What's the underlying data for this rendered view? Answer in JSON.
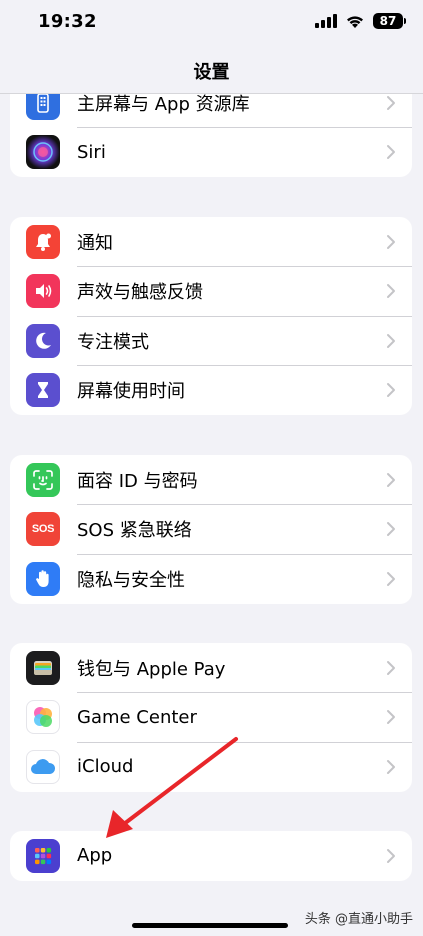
{
  "status": {
    "time": "19:32",
    "battery": "87"
  },
  "nav": {
    "title": "设置"
  },
  "groups": [
    {
      "items": [
        {
          "label": "主屏幕与 App 资源库",
          "icon": "home-screen-icon",
          "color": "#2f6fe0"
        },
        {
          "label": "Siri",
          "icon": "siri-icon",
          "color": "#1c1c2e"
        }
      ]
    },
    {
      "items": [
        {
          "label": "通知",
          "icon": "bell-icon",
          "color": "#f44336"
        },
        {
          "label": "声效与触感反馈",
          "icon": "speaker-icon",
          "color": "#f2355b"
        },
        {
          "label": "专注模式",
          "icon": "moon-icon",
          "color": "#5b4fcf"
        },
        {
          "label": "屏幕使用时间",
          "icon": "hourglass-icon",
          "color": "#5b4fcf"
        }
      ]
    },
    {
      "items": [
        {
          "label": "面容 ID 与密码",
          "icon": "face-id-icon",
          "color": "#34c759"
        },
        {
          "label": "SOS 紧急联络",
          "icon": "sos-icon",
          "color": "#f04438"
        },
        {
          "label": "隐私与安全性",
          "icon": "hand-icon",
          "color": "#2f7cf6"
        }
      ]
    },
    {
      "items": [
        {
          "label": "钱包与 Apple Pay",
          "icon": "wallet-icon",
          "color": "#1c1c1e"
        },
        {
          "label": "Game Center",
          "icon": "game-center-icon",
          "color": "#ffffff"
        },
        {
          "label": "iCloud",
          "icon": "icloud-icon",
          "color": "#ffffff"
        }
      ]
    },
    {
      "items": [
        {
          "label": "App",
          "icon": "apps-grid-icon",
          "color": "#4b3fcf"
        }
      ]
    }
  ],
  "sos_icon_text": "SOS",
  "watermark": "头条 @直通小助手"
}
